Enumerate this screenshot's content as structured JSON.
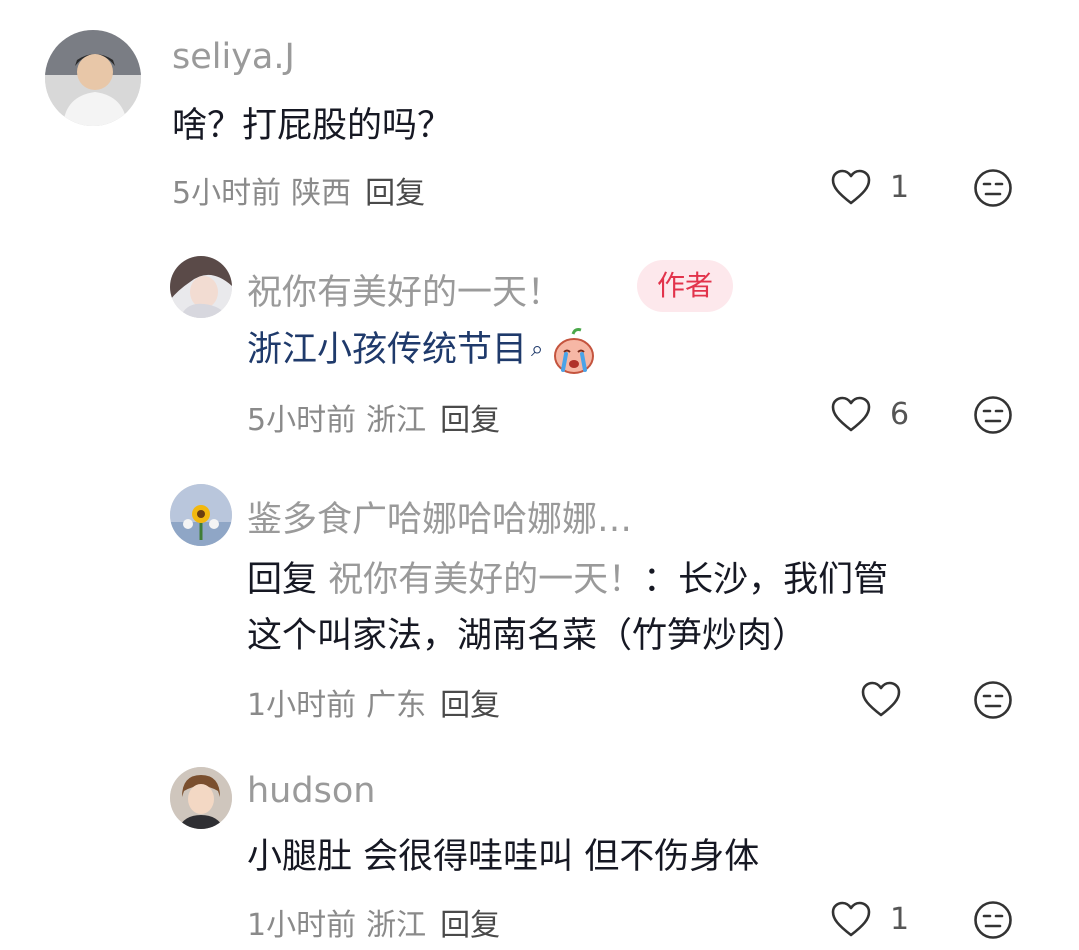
{
  "comments": [
    {
      "username": "seliya.J",
      "text": "啥？打屁股的吗？",
      "time": "5小时前",
      "location": "陕西",
      "reply_label": "回复",
      "likes": "1"
    },
    {
      "username": "祝你有美好的一天！",
      "badge": "作者",
      "text": "浙江小孩传统节目",
      "time": "5小时前",
      "location": "浙江",
      "reply_label": "回复",
      "likes": "6"
    },
    {
      "username": "鉴多食广哈娜哈哈娜娜…",
      "reply_prefix": "回复",
      "reply_target": "祝你有美好的一天！",
      "text_line1_rest": "：长沙，我们管",
      "text_line2": "这个叫家法，湖南名菜（竹笋炒肉）",
      "time": "1小时前",
      "location": "广东",
      "reply_label": "回复",
      "likes": ""
    },
    {
      "username": "hudson",
      "text": "小腿肚 会很得哇哇叫 但不伤身体",
      "time": "1小时前",
      "location": "浙江",
      "reply_label": "回复",
      "likes": "1"
    }
  ],
  "icons": {
    "like": "heart-outline-icon",
    "dislike": "neutral-face-icon",
    "search_mark": "search-icon",
    "emoji": "crying-peach-emoji"
  },
  "colors": {
    "author_badge_bg": "#fde8ec",
    "author_badge_text": "#e2334b",
    "link_text": "#1f3a6b"
  }
}
